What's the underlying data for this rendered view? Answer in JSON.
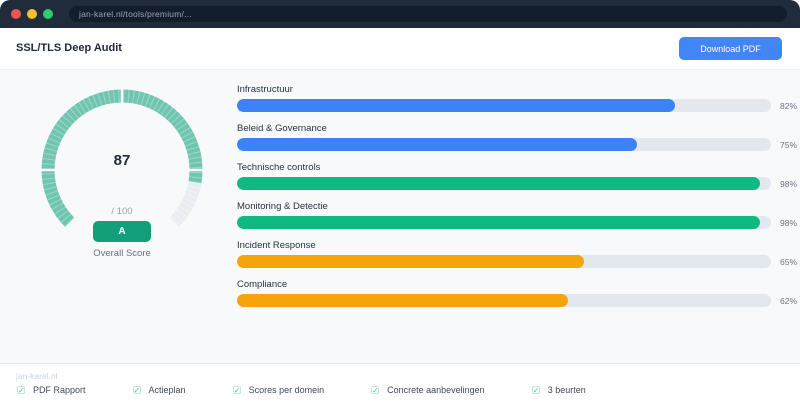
{
  "browser": {
    "url": "jan-karel.nl/tools/premium/..."
  },
  "header": {
    "title": "SSL/TLS Deep Audit",
    "download_button": "Download PDF"
  },
  "gauge": {
    "score": "87",
    "max_label": "/ 100",
    "grade": "A",
    "label": "Overall Score",
    "percent": 87,
    "arc_color": "#6fc5af",
    "track_color": "#e9edf1"
  },
  "chart_data": {
    "type": "bar",
    "orientation": "horizontal",
    "categories": [
      "Infrastructuur",
      "Beleid & Governance",
      "Technische controls",
      "Monitoring & Detectie",
      "Incident Response",
      "Compliance"
    ],
    "values": [
      82,
      75,
      98,
      98,
      65,
      62
    ],
    "value_labels": [
      "82%",
      "75%",
      "98%",
      "98%",
      "65%",
      "62%"
    ],
    "colors": [
      "#3b82f6",
      "#3b82f6",
      "#10b981",
      "#10b981",
      "#f5a40b",
      "#f5a40b"
    ],
    "xlim": [
      0,
      100
    ],
    "grid": false,
    "legend": false
  },
  "footer": {
    "brand": "jan-karel.nl",
    "check_icon": "✓",
    "items": [
      "PDF Rapport",
      "Actieplan",
      "Scores per domein",
      "Concrete aanbevelingen",
      "3 beurten"
    ]
  },
  "colors": {
    "accent_blue": "#4285f4",
    "chrome_bg": "#202b3b",
    "main_bg": "#f7f9fb",
    "badge_green": "#12a07a"
  }
}
